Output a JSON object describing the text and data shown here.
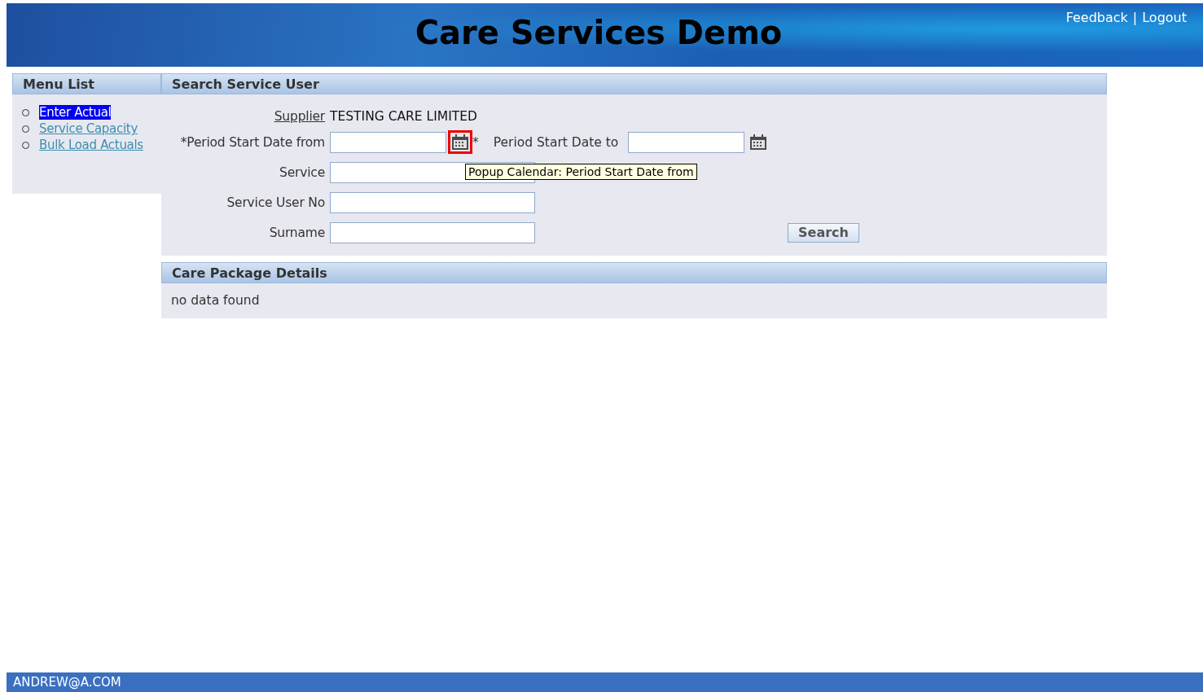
{
  "header": {
    "title": "Care Services Demo",
    "links": [
      {
        "label": "Feedback"
      },
      {
        "label": "Logout"
      }
    ],
    "separator": "|"
  },
  "menu": {
    "title": "Menu List",
    "items": [
      {
        "label": "Enter Actual",
        "selected": true
      },
      {
        "label": "Service Capacity",
        "selected": false
      },
      {
        "label": "Bulk Load Actuals",
        "selected": false
      }
    ]
  },
  "search": {
    "title": "Search Service User",
    "supplier_label": "Supplier",
    "supplier_value": "TESTING CARE LIMITED",
    "date_from": {
      "label": "*Period Start Date from",
      "calendar_focused": true
    },
    "required_mark": "*",
    "date_to": {
      "label": "Period Start Date to",
      "calendar_focused": false
    },
    "fields": [
      {
        "label": "Service"
      },
      {
        "label": "Service User No"
      },
      {
        "label": "Surname"
      }
    ],
    "search_button": "Search",
    "tooltip": "Popup Calendar: Period Start Date from"
  },
  "results": {
    "title": "Care Package Details",
    "message": "no data found"
  },
  "footer": {
    "user": "ANDREW@A.COM"
  }
}
